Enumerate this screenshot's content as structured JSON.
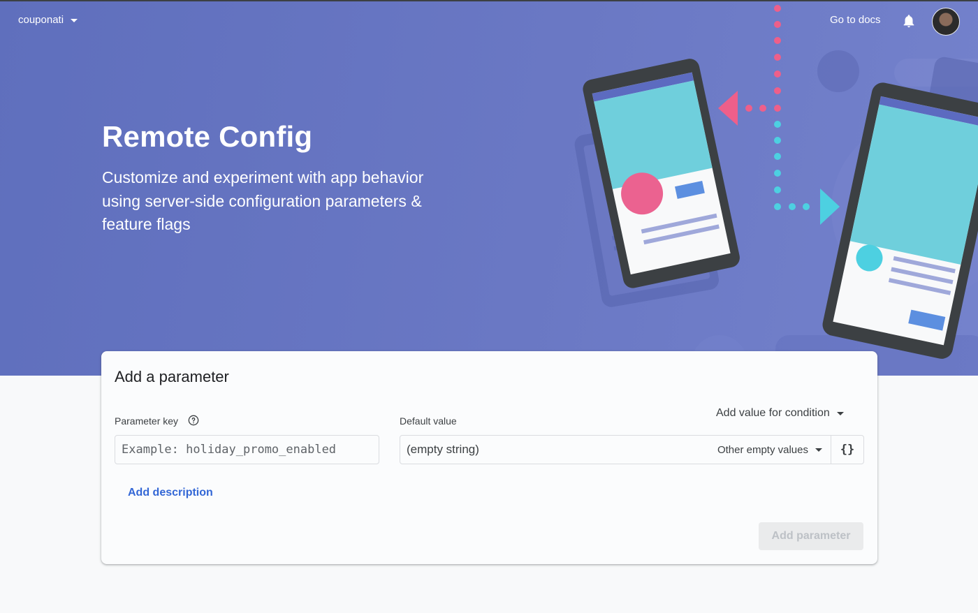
{
  "header": {
    "project_name": "couponati",
    "docs_link": "Go to docs",
    "icons": [
      "dropdown-caret-icon",
      "bell-icon",
      "avatar"
    ]
  },
  "hero": {
    "title": "Remote Config",
    "subtitle": "Customize and experiment with app behavior using server-side configuration parameters & feature flags"
  },
  "form": {
    "title": "Add a parameter",
    "key_label": "Parameter key",
    "key_placeholder": "Example: holiday_promo_enabled",
    "default_label": "Default value",
    "default_value": "(empty string)",
    "other_empty_values": "Other empty values",
    "json_button": "{}",
    "add_condition": "Add value for condition",
    "add_description": "Add description",
    "add_parameter": "Add parameter"
  },
  "colors": {
    "hero_bg": "#6675c1",
    "link": "#3367d6",
    "disabled_button_bg": "#eaebec",
    "disabled_button_text": "#bdc1c6"
  }
}
